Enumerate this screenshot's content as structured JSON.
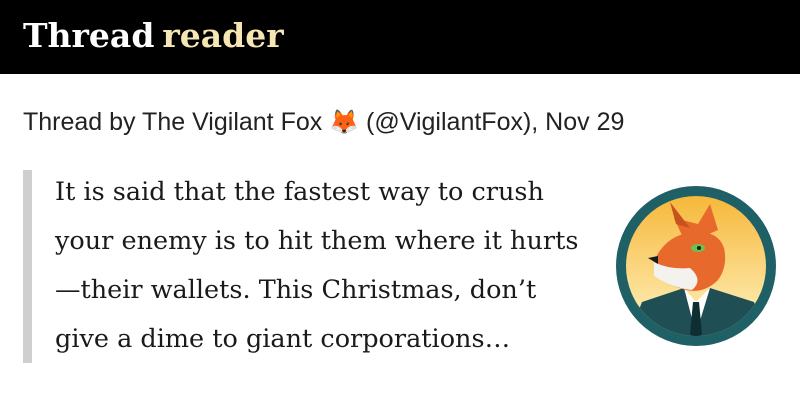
{
  "header": {
    "logo_part1": "Thread",
    "logo_part2": "reader",
    "colors": {
      "background": "#000000",
      "logo_part1": "#ffffff",
      "logo_part2": "#f6e6b4"
    }
  },
  "thread": {
    "byline_prefix": "Thread by The Vigilant Fox",
    "byline_emoji": "🦊",
    "byline_suffix": "(@VigilantFox), Nov 29",
    "text_lines": [
      "It is said that the fastest way to crush",
      "your enemy is to hit them where it hurts",
      "—their wallets. This Christmas, don’t",
      "give a dime to giant corporations…"
    ],
    "avatar": {
      "icon": "fox-in-suit-avatar",
      "colors": {
        "ring": "#1f5f66",
        "sun_top": "#f6b83a",
        "sun_bottom": "#fff3c2",
        "fox": "#e8692c"
      }
    }
  }
}
